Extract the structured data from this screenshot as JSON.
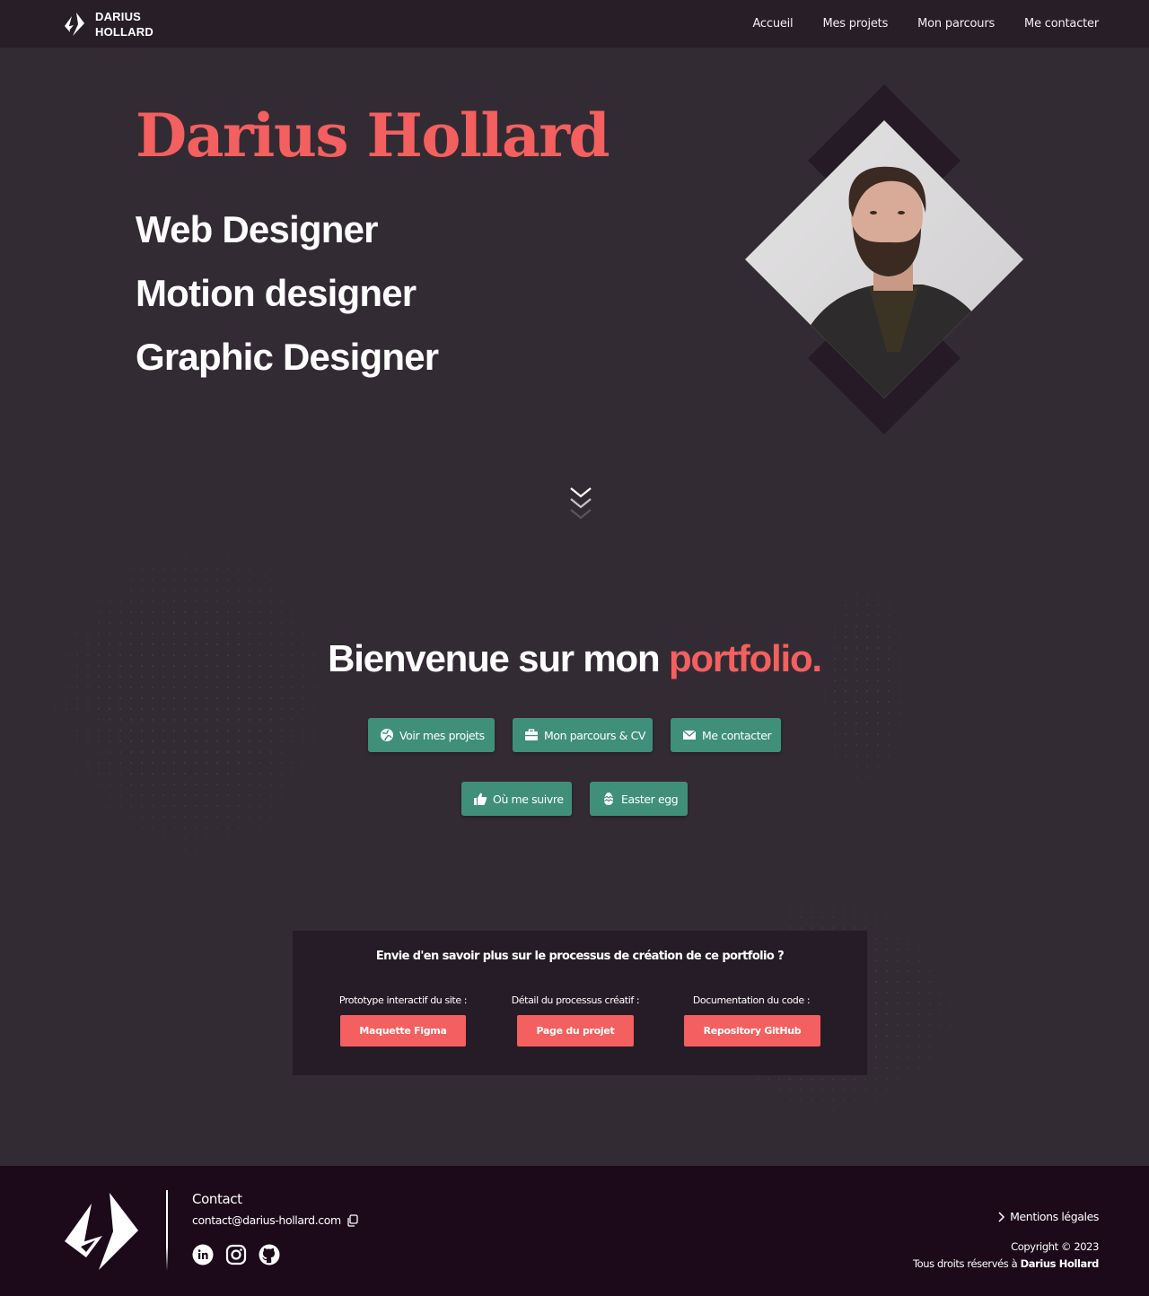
{
  "navbar": {
    "brand_line1": "DARIUS",
    "brand_line2": "HOLLARD",
    "links": [
      "Accueil",
      "Mes projets",
      "Mon parcours",
      "Me contacter"
    ]
  },
  "hero": {
    "name": "Darius Hollard",
    "roles": [
      "Web Designer",
      "Motion designer",
      "Graphic Designer"
    ]
  },
  "welcome": {
    "text": "Bienvenue sur mon",
    "accent": "portfolio."
  },
  "buttons_row1": [
    {
      "label": "Voir mes projets",
      "icon": "globe-icon"
    },
    {
      "label": "Mon parcours & CV",
      "icon": "briefcase-icon"
    },
    {
      "label": "Me contacter",
      "icon": "envelope-icon"
    }
  ],
  "buttons_row2": [
    {
      "label": "Où me suivre",
      "icon": "thumbs-up-icon"
    },
    {
      "label": "Easter egg",
      "icon": "egg-icon"
    }
  ],
  "process": {
    "title": "Envie d'en savoir plus sur le processus de création de ce portfolio ?",
    "columns": [
      {
        "label": "Prototype interactif du site :",
        "button": "Maquette Figma"
      },
      {
        "label": "Détail du processus créatif :",
        "button": "Page du projet"
      },
      {
        "label": "Documentation du code :",
        "button": "Repository GitHub"
      }
    ]
  },
  "footer": {
    "contact_title": "Contact",
    "email": "contact@darius-hollard.com",
    "socials": [
      "linkedin-icon",
      "instagram-icon",
      "github-icon"
    ],
    "legal": "Mentions légales",
    "copyright": "Copyright © 2023",
    "rights_prefix": "Tous droits réservés à",
    "rights_name": "Darius Hollard"
  },
  "colors": {
    "background": "#332b33",
    "navbar": "#271e28",
    "accent_red": "#f45f5f",
    "button_green": "#3f8f79",
    "footer": "#1c0a1b"
  }
}
